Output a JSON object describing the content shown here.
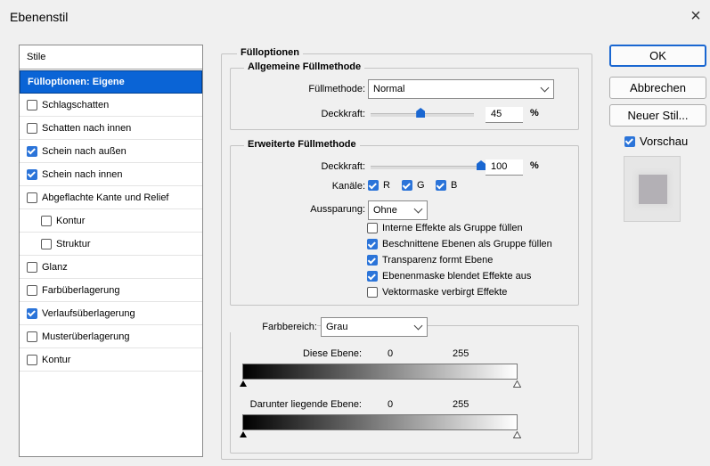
{
  "window": {
    "title": "Ebenenstil",
    "close_symbol": "×"
  },
  "styles": {
    "header": "Stile",
    "items": [
      {
        "label": "Fülloptionen: Eigene",
        "checkbox": false,
        "checked": false,
        "selected": true,
        "indent": false
      },
      {
        "label": "Schlagschatten",
        "checkbox": true,
        "checked": false,
        "selected": false,
        "indent": false
      },
      {
        "label": "Schatten nach innen",
        "checkbox": true,
        "checked": false,
        "selected": false,
        "indent": false
      },
      {
        "label": "Schein nach außen",
        "checkbox": true,
        "checked": true,
        "selected": false,
        "indent": false
      },
      {
        "label": "Schein nach innen",
        "checkbox": true,
        "checked": true,
        "selected": false,
        "indent": false
      },
      {
        "label": "Abgeflachte Kante und Relief",
        "checkbox": true,
        "checked": false,
        "selected": false,
        "indent": false
      },
      {
        "label": "Kontur",
        "checkbox": true,
        "checked": false,
        "selected": false,
        "indent": true
      },
      {
        "label": "Struktur",
        "checkbox": true,
        "checked": false,
        "selected": false,
        "indent": true
      },
      {
        "label": "Glanz",
        "checkbox": true,
        "checked": false,
        "selected": false,
        "indent": false
      },
      {
        "label": "Farbüberlagerung",
        "checkbox": true,
        "checked": false,
        "selected": false,
        "indent": false
      },
      {
        "label": "Verlaufsüberlagerung",
        "checkbox": true,
        "checked": true,
        "selected": false,
        "indent": false
      },
      {
        "label": "Musterüberlagerung",
        "checkbox": true,
        "checked": false,
        "selected": false,
        "indent": false
      },
      {
        "label": "Kontur",
        "checkbox": true,
        "checked": false,
        "selected": false,
        "indent": false
      }
    ]
  },
  "fill_options": {
    "title": "Fülloptionen",
    "general": {
      "title": "Allgemeine Füllmethode",
      "blend_label": "Füllmethode:",
      "blend_value": "Normal",
      "opacity_label": "Deckkraft:",
      "opacity_value": "45",
      "opacity_unit": "%",
      "opacity_slider_fraction": 0.45
    },
    "advanced": {
      "title": "Erweiterte Füllmethode",
      "opacity_label": "Deckkraft:",
      "opacity_value": "100",
      "opacity_unit": "%",
      "opacity_slider_fraction": 1.0,
      "channels_label": "Kanäle:",
      "channels": [
        {
          "label": "R",
          "checked": true
        },
        {
          "label": "G",
          "checked": true
        },
        {
          "label": "B",
          "checked": true
        }
      ],
      "knockout_label": "Aussparung:",
      "knockout_value": "Ohne",
      "options": [
        {
          "label": "Interne Effekte als Gruppe füllen",
          "checked": false
        },
        {
          "label": "Beschnittene Ebenen als Gruppe füllen",
          "checked": true
        },
        {
          "label": "Transparenz formt Ebene",
          "checked": true
        },
        {
          "label": "Ebenenmaske blendet Effekte aus",
          "checked": true
        },
        {
          "label": "Vektormaske verbirgt Effekte",
          "checked": false
        }
      ]
    },
    "blend_if": {
      "label": "Farbbereich:",
      "value": "Grau",
      "this_layer_label": "Diese Ebene:",
      "this_layer_min": "0",
      "this_layer_max": "255",
      "underlying_label": "Darunter liegende Ebene:",
      "underlying_min": "0",
      "underlying_max": "255"
    }
  },
  "buttons": {
    "ok": "OK",
    "cancel": "Abbrechen",
    "new_style": "Neuer Stil...",
    "preview_label": "Vorschau",
    "preview_checked": true
  },
  "colors": {
    "accent": "#0a64d6",
    "checkbox_on": "#2b74d9",
    "slider_thumb": "#1a67d1",
    "preview_swatch": "#b3b0b5"
  }
}
